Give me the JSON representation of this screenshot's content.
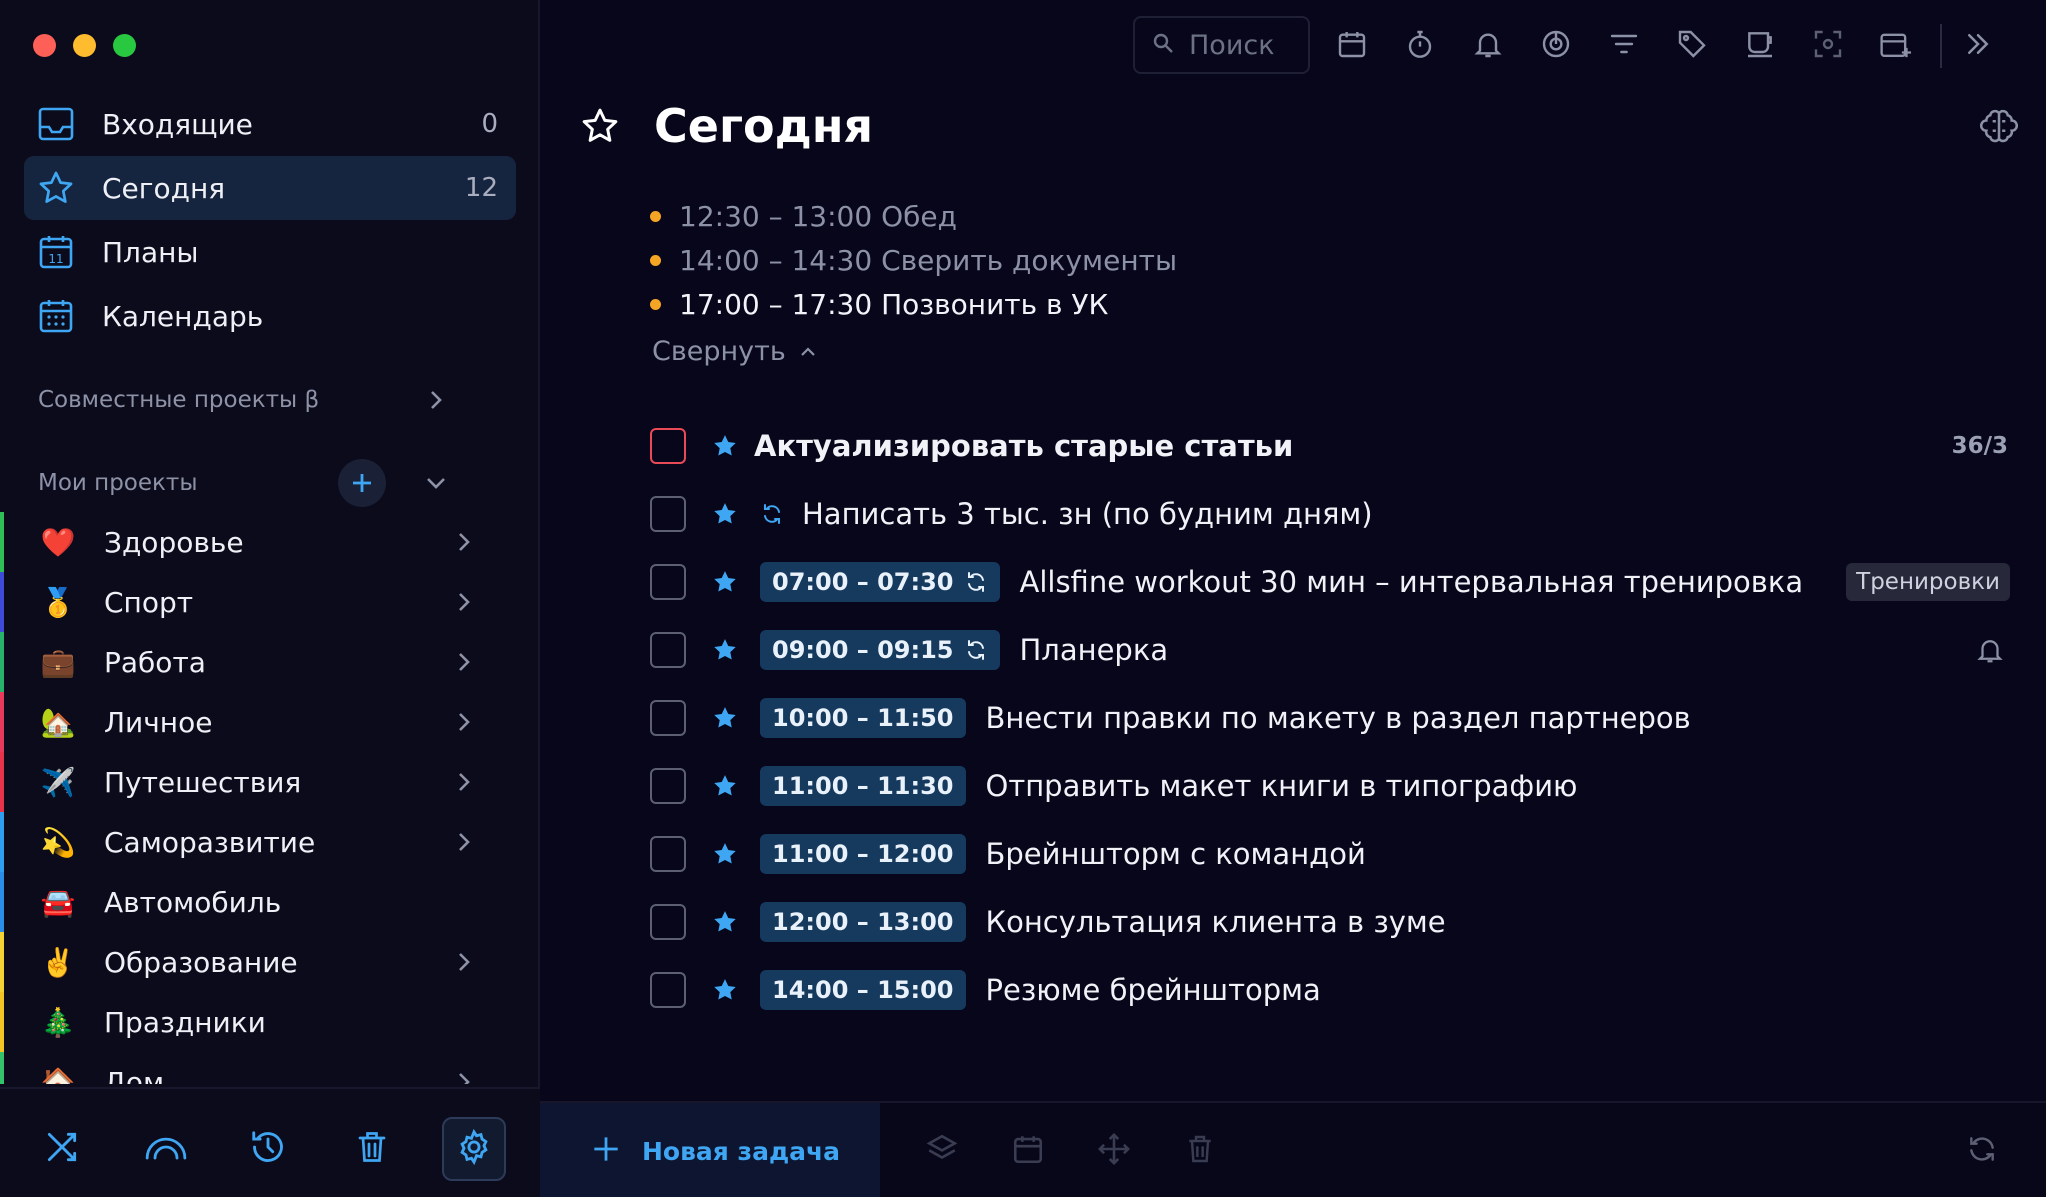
{
  "colors": {
    "accent": "#3fa6f3",
    "event_dot": "#f5a524",
    "urgent_checkbox": "#e94a58",
    "active_nav_bg": "#152540",
    "time_badge_bg": "#16395e"
  },
  "sidebar": {
    "nav": [
      {
        "label": "Входящие",
        "count": "0",
        "icon": "inbox-icon"
      },
      {
        "label": "Сегодня",
        "count": "12",
        "icon": "star-icon",
        "active": true
      },
      {
        "label": "Планы",
        "count": "",
        "icon": "calendar-day-icon"
      },
      {
        "label": "Календарь",
        "count": "",
        "icon": "calendar-grid-icon"
      }
    ],
    "shared_projects_label": "Совместные проекты β",
    "my_projects_label": "Мои проекты",
    "projects": [
      {
        "label": "Здоровье",
        "emoji": "❤️",
        "color": "#2fbf57",
        "has_children": true
      },
      {
        "label": "Спорт",
        "emoji": "🥇",
        "color": "#3d4bd8",
        "has_children": true
      },
      {
        "label": "Работа",
        "emoji": "💼",
        "color": "#27b36a",
        "has_children": true
      },
      {
        "label": "Личное",
        "emoji": "🏡",
        "color": "#e83a5b",
        "has_children": true
      },
      {
        "label": "Путешествия",
        "emoji": "✈️",
        "color": "#e8334a",
        "has_children": true
      },
      {
        "label": "Саморазвитие",
        "emoji": "💫",
        "color": "#2f9df0",
        "has_children": true
      },
      {
        "label": "Автомобиль",
        "emoji": "🚘",
        "color": "#2a8ee6",
        "has_children": false
      },
      {
        "label": "Образование",
        "emoji": "✌️",
        "color": "#f3d334",
        "has_children": true
      },
      {
        "label": "Праздники",
        "emoji": "🎄",
        "color": "#f2c525",
        "has_children": false
      },
      {
        "label": "Дом",
        "emoji": "🏠",
        "color": "#34c26a",
        "has_children": true
      }
    ],
    "bottom_icons": [
      "shuffle-icon",
      "rainbow-icon",
      "history-icon",
      "trash-icon",
      "settings-icon"
    ]
  },
  "toolbar": {
    "search_placeholder": "Поиск",
    "icons": [
      "calendar-icon",
      "timer-icon",
      "bell-icon",
      "focus-icon",
      "filter-icon",
      "tag-icon",
      "coffee-icon",
      "screenshot-icon",
      "add-to-calendar-icon",
      "expand-icon"
    ]
  },
  "main": {
    "title": "Сегодня",
    "events": [
      {
        "text": "12:30 – 13:00 Обед",
        "current": false
      },
      {
        "text": "14:00 – 14:30 Сверить документы",
        "current": false
      },
      {
        "text": "17:00 – 17:30 Позвонить в УК",
        "current": true
      }
    ],
    "collapse_label": "Свернуть",
    "tasks": [
      {
        "title": "Актуализировать старые статьи",
        "bold": true,
        "urgent": true,
        "time": "",
        "repeat": false,
        "counter": "36/3",
        "tag": "",
        "bell": false
      },
      {
        "title": "Написать 3 тыс. зн (по будним дням)",
        "bold": false,
        "urgent": false,
        "time": "",
        "repeat": true,
        "counter": "",
        "tag": "",
        "bell": false
      },
      {
        "title": "Allsfine workout 30 мин – интервальная тренировка",
        "bold": false,
        "urgent": false,
        "time": "07:00 – 07:30",
        "time_repeat": true,
        "counter": "",
        "tag": "Тренировки",
        "bell": false
      },
      {
        "title": "Планерка",
        "bold": false,
        "urgent": false,
        "time": "09:00 – 09:15",
        "time_repeat": true,
        "counter": "",
        "tag": "",
        "bell": true
      },
      {
        "title": "Внести правки по макету в раздел партнеров",
        "bold": false,
        "urgent": false,
        "time": "10:00 – 11:50",
        "counter": "",
        "tag": "",
        "bell": false
      },
      {
        "title": "Отправить макет книги в типографию",
        "bold": false,
        "urgent": false,
        "time": "11:00 – 11:30",
        "counter": "",
        "tag": "",
        "bell": false
      },
      {
        "title": "Брейншторм с командой",
        "bold": false,
        "urgent": false,
        "time": "11:00 – 12:00",
        "counter": "",
        "tag": "",
        "bell": false
      },
      {
        "title": "Консультация клиента в зуме",
        "bold": false,
        "urgent": false,
        "time": "12:00 – 13:00",
        "counter": "",
        "tag": "",
        "bell": false
      },
      {
        "title": "Резюме брейншторма",
        "bold": false,
        "urgent": false,
        "time": "14:00 – 15:00",
        "counter": "",
        "tag": "",
        "bell": false
      }
    ],
    "new_task_label": "Новая задача"
  }
}
